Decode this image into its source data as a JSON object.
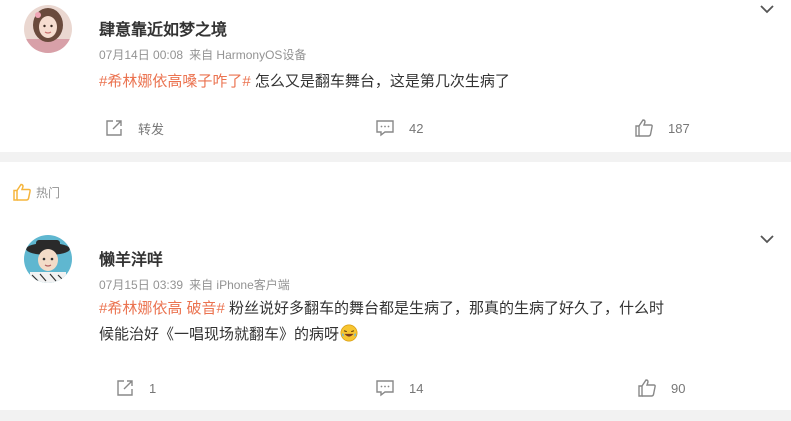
{
  "post1": {
    "username": "肆意靠近如梦之境",
    "time": "07月14日 00:08",
    "source": "来自 HarmonyOS设备",
    "tag": "#希林娜依高嗓子咋了#",
    "text": " 怎么又是翻车舞台，这是第几次生病了",
    "repost_label": "转发",
    "comment_count": "42",
    "like_count": "187"
  },
  "hot_section": {
    "label": "热门"
  },
  "post2": {
    "username": "懒羊洋咩",
    "time": "07月15日 03:39",
    "source": "来自 iPhone客户端",
    "tag": "#希林娜依高 破音#",
    "text_line1": " 粉丝说好多翻车的舞台都是生病了，那真的生病了好久了，什么时",
    "text_line2": "候能治好《一唱现场就翻车》的病呀",
    "repost_count": "1",
    "comment_count": "14",
    "like_count": "90"
  },
  "icons": {
    "repost": "share-arrow-icon",
    "comment": "comment-bubble-icon",
    "like": "thumbs-up-icon",
    "hot": "thumbs-up-outline-icon",
    "menu": "chevron-down-icon",
    "emoji": "laughing-crying-emoji-icon"
  },
  "colors": {
    "topic": "#eb7350",
    "meta": "#939393",
    "hot_icon": "#f5b53d",
    "separator": "#f2f2f2"
  }
}
